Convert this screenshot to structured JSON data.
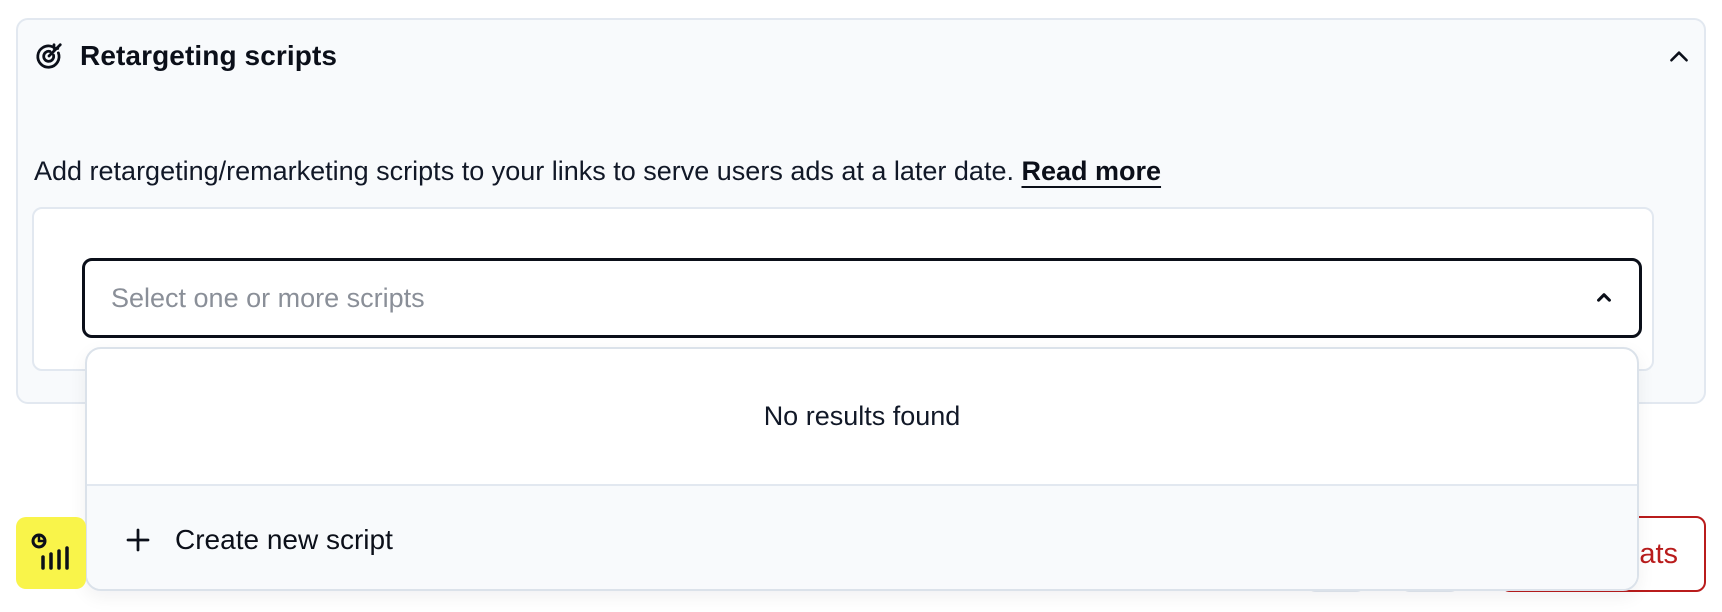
{
  "panel": {
    "title": "Retargeting scripts",
    "description": "Add retargeting/remarketing scripts to your links to serve users ads at a later date.",
    "read_more_label": "Read more"
  },
  "select": {
    "placeholder": "Select one or more scripts"
  },
  "dropdown": {
    "empty_message": "No results found",
    "create_label": "Create new script"
  },
  "footer": {
    "stats_label_visible": "ats"
  },
  "colors": {
    "brand_yellow": "#f9f44a",
    "danger": "#b91c1c",
    "panel_bg": "#f8fafc",
    "border": "#e2e8f0"
  },
  "icons": {
    "panel": "target-arrow-icon",
    "collapse": "chevron-up-icon",
    "select": "chevron-up-icon",
    "create": "plus-icon",
    "brand": "analytics-logo-icon"
  }
}
